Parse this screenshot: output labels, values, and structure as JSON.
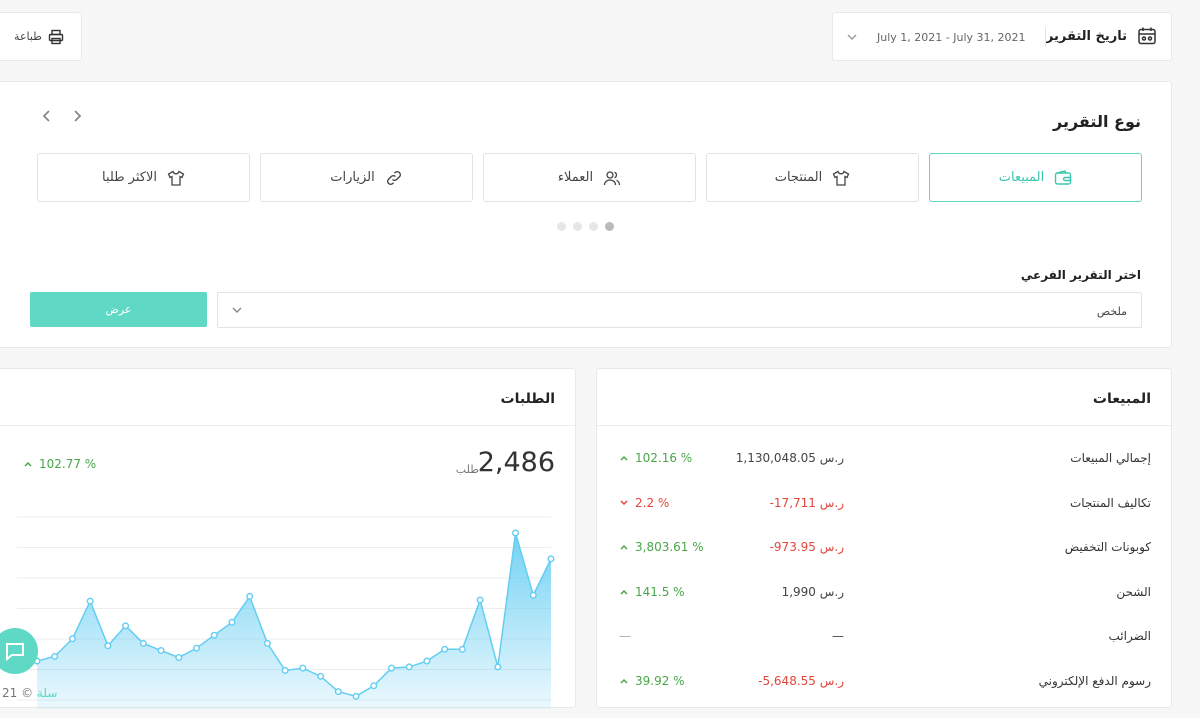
{
  "toolbar": {
    "print_label": "طباعة",
    "date_title": "تاريخ التقرير",
    "date_range": "July 1, 2021 - July 31, 2021"
  },
  "report_type": {
    "title": "نوع التقرير",
    "tiles": [
      {
        "label": "المبيعات",
        "icon": "wallet-icon",
        "active": true
      },
      {
        "label": "المنتجات",
        "icon": "tshirt-icon",
        "active": false
      },
      {
        "label": "العملاء",
        "icon": "users-icon",
        "active": false
      },
      {
        "label": "الزيارات",
        "icon": "link-icon",
        "active": false
      },
      {
        "label": "الاكثر طلبا",
        "icon": "tshirt-icon",
        "active": false
      }
    ],
    "carousel_pages": 4,
    "carousel_active": 0,
    "sub_report_label": "اختر التقرير الفرعي",
    "sub_report_value": "ملخص",
    "show_button": "عرض"
  },
  "sales": {
    "title": "المبيعات",
    "rows": [
      {
        "label": "إجمالي المبيعات",
        "value": "1,130,048.05 ر.س",
        "change": "102.16 %",
        "trend": "up"
      },
      {
        "label": "تكاليف المنتجات",
        "value": "-17,711 ر.س",
        "change": "2.2 %",
        "trend": "down"
      },
      {
        "label": "كوبونات التخفيض",
        "value": "-973.95 ر.س",
        "change": "3,803.61 %",
        "trend": "up"
      },
      {
        "label": "الشحن",
        "value": "1,990 ر.س",
        "change": "141.5 %",
        "trend": "up"
      },
      {
        "label": "الضرائب",
        "value": "—",
        "change": "—",
        "trend": "none"
      },
      {
        "label": "رسوم الدفع الإلكتروني",
        "value": "-5,648.55 ر.س",
        "change": "39.92 %",
        "trend": "up"
      }
    ]
  },
  "orders": {
    "title": "الطلبات",
    "count": "2,486",
    "unit": "طلب",
    "change": "102.77 %",
    "trend": "up"
  },
  "chart_data": {
    "type": "area",
    "title": "",
    "xlabel": "",
    "ylabel": "",
    "grid": true,
    "values": [
      14,
      18,
      33,
      65,
      27,
      44,
      29,
      23,
      17,
      25,
      36,
      47,
      69,
      29,
      6,
      8,
      1,
      -12,
      -16,
      -7,
      8,
      9,
      14,
      24,
      24,
      66,
      9,
      123,
      70,
      101
    ],
    "ylim": [
      -20,
      140
    ],
    "color": "#5fd8c5"
  },
  "footer": {
    "text": "21 ©",
    "brand": "سلة"
  },
  "colors": {
    "accent": "#5fd8c5",
    "positive": "#4aa64a",
    "negative": "#e2463b"
  }
}
